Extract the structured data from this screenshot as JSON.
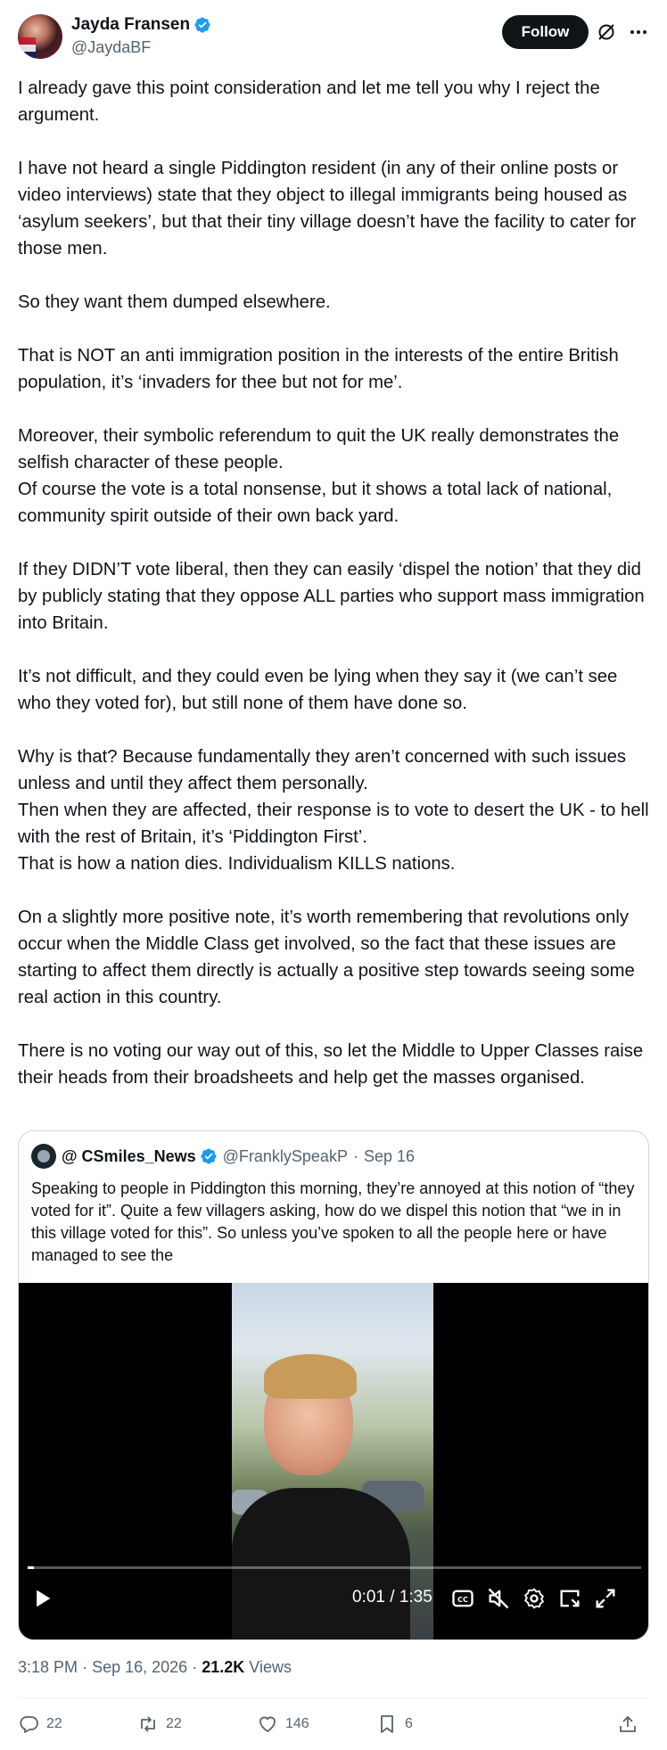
{
  "author": {
    "name": "Jayda Fransen",
    "handle": "@JaydaBF",
    "follow_label": "Follow"
  },
  "tweet": {
    "paragraphs": [
      "I already gave this point consideration and let me tell you why I reject the argument.",
      "I have not heard a single Piddington resident (in any of their online posts or video interviews) state that they object to illegal immigrants being housed as ‘asylum seekers’, but that their tiny village doesn’t have the facility to cater for those men.",
      "So they want them dumped elsewhere.",
      "That is NOT an anti immigration position in the interests of the entire British population, it’s ‘invaders for thee but not for me’.",
      "Moreover, their symbolic referendum to quit the UK really demonstrates the selfish character of these people.",
      "Of course the vote is a total nonsense, but it shows a total lack of national, community spirit outside of their own back yard.",
      "If they DIDN’T vote liberal, then they can easily ‘dispel the notion’ that they did by publicly stating that they oppose ALL parties who support mass immigration into Britain.",
      "It’s not difficult, and they could even be lying when they say it (we can’t see who they voted for), but still none of them have done so.",
      "Why is that? Because fundamentally they aren’t concerned with such issues unless and until they affect them personally.",
      "Then when they are affected, their response is to vote to desert the UK - to hell with the rest of Britain, it’s ‘Piddington First’.",
      "That is how a nation dies. Individualism KILLS nations.",
      "On a slightly more positive note, it’s worth remembering that revolutions only occur when the Middle Class get involved, so the fact that these issues are starting to affect them directly is actually a positive step towards seeing some real action in this country.",
      "There is no voting our way out of this, so let the Middle to Upper Classes raise their heads from their broadsheets and help get the masses organised."
    ]
  },
  "quote": {
    "name": "@ CSmiles_News",
    "handle": "@FranklySpeakP",
    "dot": "·",
    "date": "Sep 16",
    "text": "Speaking to people in Piddington this morning, they’re annoyed at this notion of “they voted for it”. Quite a few villagers asking, how do we dispel this notion that “we in in this village voted for this”. So unless you’ve spoken to all the people here or have managed to see the",
    "video": {
      "time": "0:01 / 1:35",
      "progress": 0.01
    }
  },
  "meta": {
    "time": "3:18 PM",
    "sep1": "·",
    "date": "Sep 16, 2026",
    "sep2": "·",
    "views_count": "21.2K",
    "views_label": "Views"
  },
  "actions": {
    "replies": "22",
    "reposts": "22",
    "likes": "146",
    "bookmarks": "6"
  },
  "colors": {
    "verified": "#1d9bf0",
    "text": "#0f1419",
    "secondary": "#536471",
    "border": "#cfd9de"
  }
}
